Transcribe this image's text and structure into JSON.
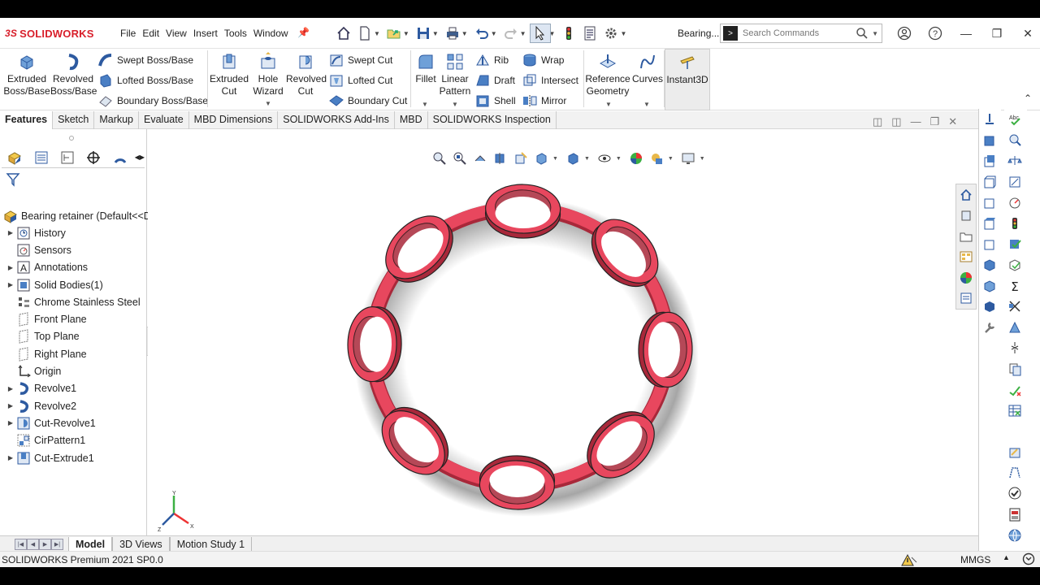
{
  "app": {
    "brand": "SOLIDWORKS",
    "brand_ds": "3S",
    "document_title": "Bearing...",
    "status_text": "SOLIDWORKS Premium 2021 SP0.0",
    "units": "MMGS"
  },
  "menu": [
    "File",
    "Edit",
    "View",
    "Insert",
    "Tools",
    "Window"
  ],
  "search": {
    "placeholder": "Search Commands"
  },
  "ribbon": {
    "extruded_boss": "Extruded\nBoss/Base",
    "revolved_boss": "Revolved\nBoss/Base",
    "swept_boss": "Swept Boss/Base",
    "lofted_boss": "Lofted Boss/Base",
    "boundary_boss": "Boundary Boss/Base",
    "extruded_cut": "Extruded\nCut",
    "hole_wizard": "Hole\nWizard",
    "revolved_cut": "Revolved\nCut",
    "swept_cut": "Swept Cut",
    "lofted_cut": "Lofted Cut",
    "boundary_cut": "Boundary Cut",
    "fillet": "Fillet",
    "linear_pattern": "Linear\nPattern",
    "rib": "Rib",
    "draft": "Draft",
    "shell": "Shell",
    "wrap": "Wrap",
    "intersect": "Intersect",
    "mirror": "Mirror",
    "reference_geometry": "Reference\nGeometry",
    "curves": "Curves",
    "instant3d": "Instant3D"
  },
  "tabs": [
    "Features",
    "Sketch",
    "Markup",
    "Evaluate",
    "MBD Dimensions",
    "SOLIDWORKS Add-Ins",
    "MBD",
    "SOLIDWORKS Inspection"
  ],
  "tree": {
    "root": "Bearing retainer  (Default<<D",
    "items": [
      {
        "label": "History",
        "expandable": true
      },
      {
        "label": "Sensors",
        "expandable": false
      },
      {
        "label": "Annotations",
        "expandable": true
      },
      {
        "label": "Solid Bodies(1)",
        "expandable": true
      },
      {
        "label": "Chrome Stainless Steel",
        "expandable": false
      },
      {
        "label": "Front Plane",
        "expandable": false
      },
      {
        "label": "Top Plane",
        "expandable": false
      },
      {
        "label": "Right Plane",
        "expandable": false
      },
      {
        "label": "Origin",
        "expandable": false
      },
      {
        "label": "Revolve1",
        "expandable": true
      },
      {
        "label": "Revolve2",
        "expandable": true
      },
      {
        "label": "Cut-Revolve1",
        "expandable": true
      },
      {
        "label": "CirPattern1",
        "expandable": false
      },
      {
        "label": "Cut-Extrude1",
        "expandable": true
      }
    ]
  },
  "bottom_tabs": [
    "Model",
    "3D Views",
    "Motion Study 1"
  ],
  "triad": {
    "x": "X",
    "y": "Y",
    "z": "Z"
  },
  "colors": {
    "part": "#e8475e",
    "part_dark": "#a8283a",
    "brand": "#d81e2a",
    "selection": "#3c7dd8"
  }
}
